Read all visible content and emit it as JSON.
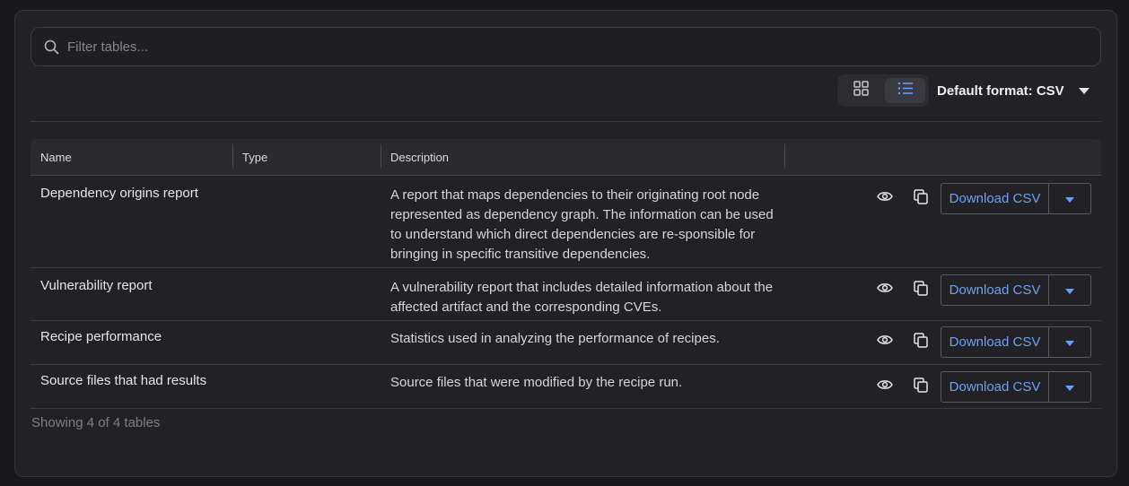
{
  "search": {
    "placeholder": "Filter tables..."
  },
  "toolbar": {
    "views": [
      "grid-view",
      "list-view"
    ],
    "active_view": "list-view",
    "default_format_label": "Default format: CSV"
  },
  "table": {
    "columns": [
      "Name",
      "Type",
      "Description"
    ],
    "rows": [
      {
        "name": "Dependency origins report",
        "type": "",
        "description": "A report that maps dependencies to their originating root node represented as dependency graph. The information can be used to understand which direct dependencies are re-sponsible for bringing in specific transitive dependencies.",
        "download_label": "Download CSV"
      },
      {
        "name": "Vulnerability report",
        "type": "",
        "description": "A vulnerability report that includes detailed information about the affected artifact and the corresponding CVEs.",
        "download_label": "Download CSV"
      },
      {
        "name": "Recipe performance",
        "type": "",
        "description": "Statistics used in analyzing the performance of recipes.",
        "download_label": "Download CSV"
      },
      {
        "name": "Source files that had results",
        "type": "",
        "description": "Source files that were modified by the recipe run.",
        "download_label": "Download CSV"
      }
    ]
  },
  "footer": {
    "summary": "Showing 4 of 4 tables"
  },
  "colors": {
    "accent": "#6da0f5",
    "background": "#19191d",
    "panel": "#222226"
  }
}
